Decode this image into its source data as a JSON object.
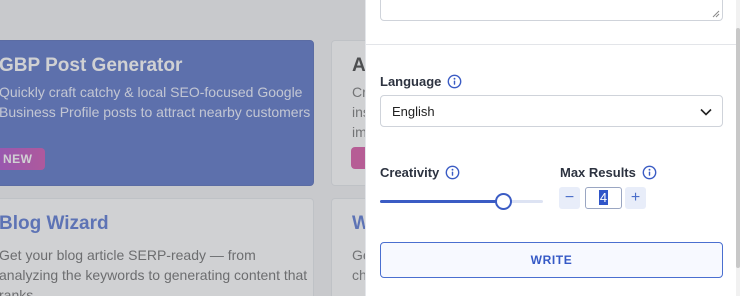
{
  "cards": [
    {
      "title": "GBP Post Generator",
      "description": "Quickly craft catchy & local SEO-focused Google Business Profile posts to attract nearby customers",
      "badge": "NEW"
    },
    {
      "title": "A",
      "description": "Cr\nins\nim"
    },
    {
      "title": "Blog Wizard",
      "description": "Get your blog article SERP-ready — from analyzing the keywords to generating content that ranks"
    },
    {
      "title": "W",
      "description": "Ge\nch"
    }
  ],
  "panel": {
    "language": {
      "label": "Language",
      "value": "English"
    },
    "creativity": {
      "label": "Creativity",
      "level": 0.76
    },
    "max_results": {
      "label": "Max Results",
      "value": "4",
      "decrement": "−",
      "increment": "+"
    },
    "write_label": "WRITE"
  },
  "colors": {
    "accent": "#3b5cc4",
    "gbp_card": "#2f4fb8",
    "badge_new_start": "#8e24c8",
    "badge_new_end": "#c2259c"
  },
  "icons": {
    "info": "info-icon",
    "chevron": "chevron-down-icon"
  }
}
